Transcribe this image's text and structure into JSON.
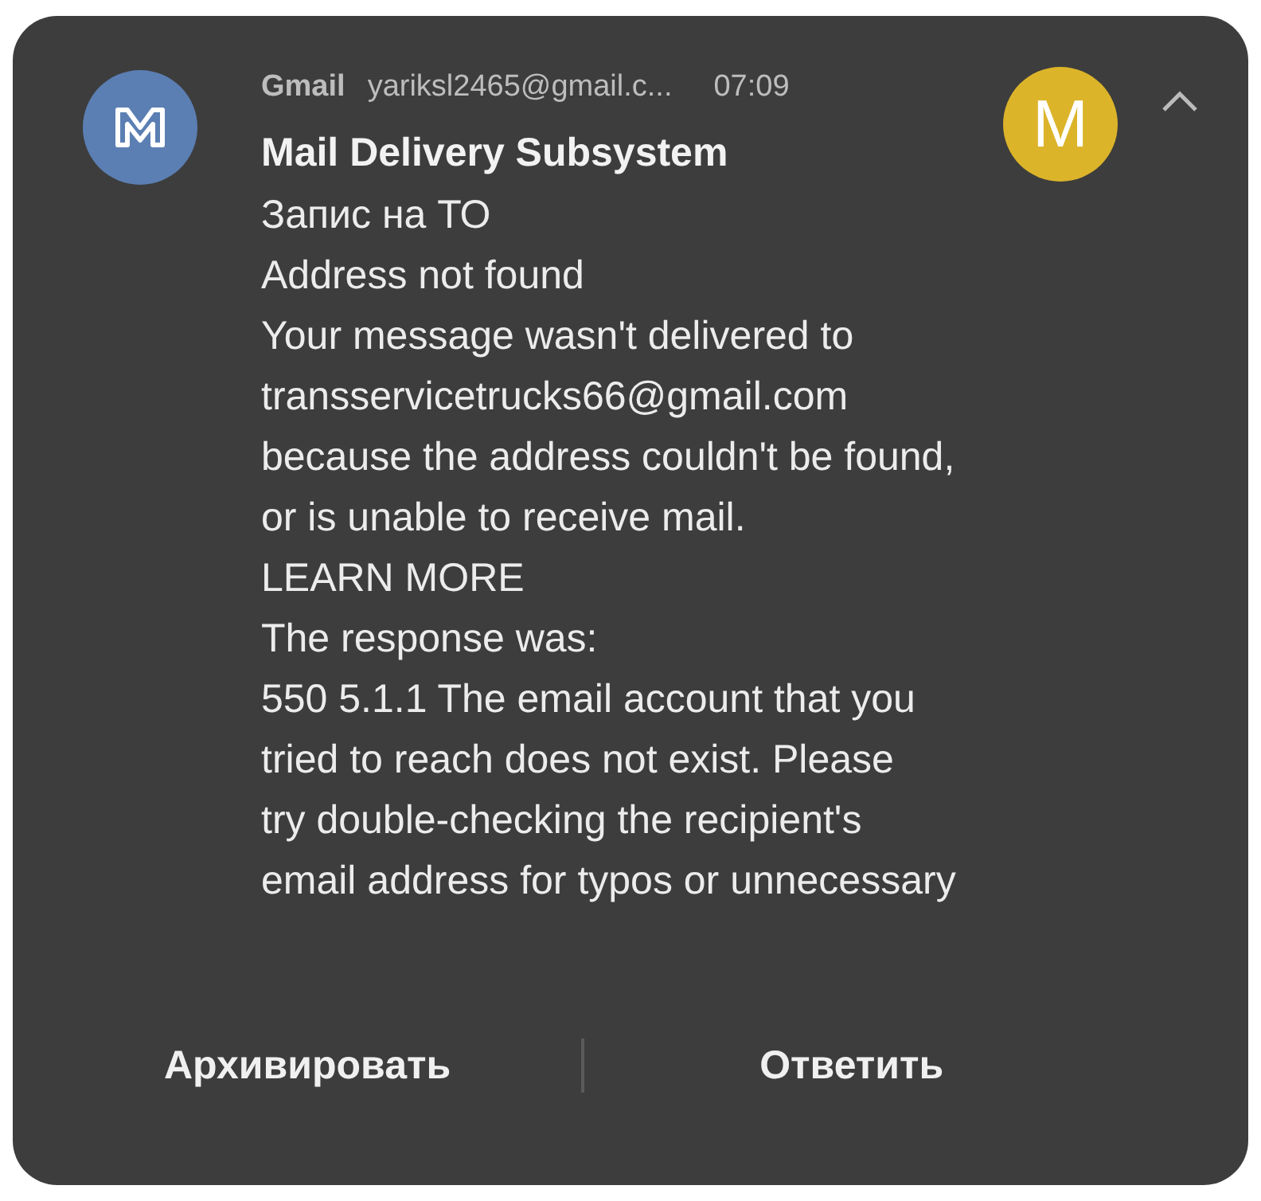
{
  "notification": {
    "app": "Gmail",
    "account": "yariksl2465@gmail.c...",
    "time": "07:09",
    "avatar_letter": "M",
    "expanded": true,
    "sender": "Mail Delivery Subsystem",
    "lines": [
      "Запис на ТО",
      "Address not found",
      "Your message wasn't delivered to",
      "transservicetrucks66@gmail.com",
      "because the address couldn't be found,",
      "or is unable to receive mail.",
      "LEARN MORE",
      "The response was:",
      "550 5.1.1 The email account that you",
      "tried to reach does not exist. Please",
      "try double-checking the recipient's",
      "email address for typos or unnecessary"
    ],
    "actions": [
      "Архивировать",
      "Ответить"
    ]
  }
}
